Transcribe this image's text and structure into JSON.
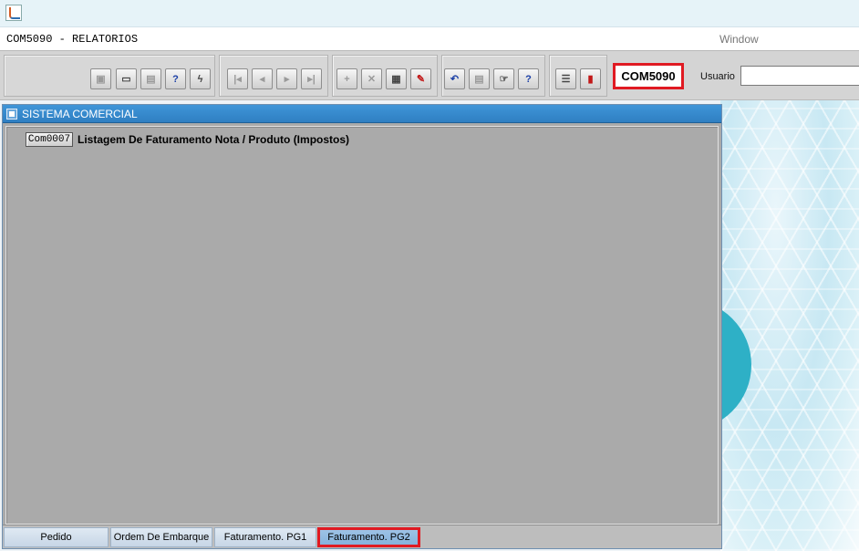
{
  "window": {
    "form_title": "COM5090 - RELATORIOS",
    "window_menu": "Window"
  },
  "toolbar": {
    "form_code": "COM5090",
    "user_label": "Usuario",
    "user_value": ""
  },
  "inner_window": {
    "title": "SISTEMA COMERCIAL",
    "rows": [
      {
        "button": "Com0007",
        "label": "Listagem De Faturamento Nota / Produto (Impostos)"
      }
    ]
  },
  "tabs": [
    {
      "label": "Pedido",
      "active": false
    },
    {
      "label": "Ordem De Embarque",
      "active": false
    },
    {
      "label": "Faturamento. PG1",
      "active": false
    },
    {
      "label": "Faturamento. PG2",
      "active": true
    }
  ],
  "colors": {
    "highlight": "#e01a22",
    "title_blue": "#2f7fc2",
    "canvas_gray": "#aaaaaa"
  }
}
